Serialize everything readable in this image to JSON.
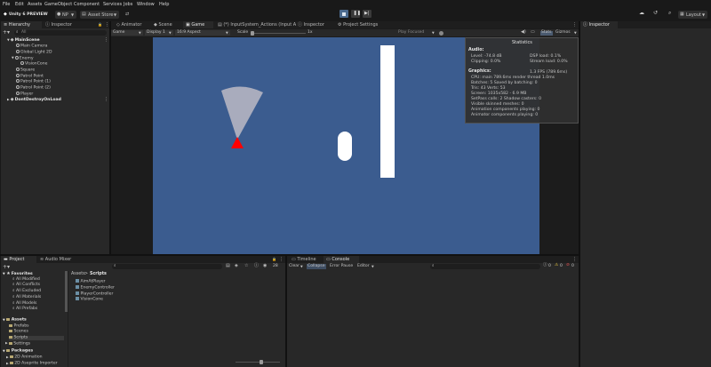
{
  "menu": [
    "File",
    "Edit",
    "Assets",
    "GameObject",
    "Component",
    "Services",
    "Jobs",
    "Window",
    "Help"
  ],
  "toolbar": {
    "app_badge": "Unity 6 PREVIEW",
    "account": "NP",
    "asset_store": "Asset Store",
    "layout": "Layout"
  },
  "tabs": {
    "hierarchy": "Hierarchy",
    "inspector_left": "Inspector",
    "animator": "Animator",
    "scene": "Scene",
    "game": "Game",
    "input_actions": "(*) InputSystem_Actions (Input A",
    "inspector_mid": "Inspector",
    "project_settings": "Project Settings",
    "inspector_right": "Inspector",
    "project": "Project",
    "audio_mixer": "Audio Mixer",
    "timeline": "Timeline",
    "console": "Console"
  },
  "game_toolbar": {
    "mode": "Game",
    "display": "Display 1",
    "aspect": "16:9 Aspect",
    "scale_label": "Scale",
    "scale_value": "1x",
    "play_focused": "Play Focused",
    "stats": "Stats",
    "gizmos": "Gizmos"
  },
  "hierarchy": {
    "search_placeholder": "All",
    "items": [
      {
        "label": "MainScene",
        "level": 0,
        "kind": "scene"
      },
      {
        "label": "Main Camera",
        "level": 2,
        "kind": "obj"
      },
      {
        "label": "Global Light 2D",
        "level": 2,
        "kind": "obj"
      },
      {
        "label": "Enemy",
        "level": 2,
        "kind": "obj"
      },
      {
        "label": "VisionCone",
        "level": 3,
        "kind": "obj"
      },
      {
        "label": "Square",
        "level": 2,
        "kind": "obj"
      },
      {
        "label": "Patrol Point",
        "level": 2,
        "kind": "obj"
      },
      {
        "label": "Patrol Point (1)",
        "level": 2,
        "kind": "obj"
      },
      {
        "label": "Patrol Point (2)",
        "level": 2,
        "kind": "obj"
      },
      {
        "label": "Player",
        "level": 2,
        "kind": "obj"
      },
      {
        "label": "DontDestroyOnLoad",
        "level": 0,
        "kind": "scene"
      }
    ]
  },
  "stats": {
    "title": "Statistics",
    "audio_header": "Audio:",
    "level": "Level: -74.8 dB",
    "clipping": "Clipping: 0.0%",
    "dsp_load": "DSP load: 0.1%",
    "stream_load": "Stream load: 0.0%",
    "graphics_header": "Graphics:",
    "fps": "1.3 FPS (789.6ms)",
    "cpu": "CPU: main 789.6ms  render thread 1.0ms",
    "batches": "Batches: 5     Saved by batching: 0",
    "tris": "Tris: 43      Verts: 53",
    "screen": "Screen: 1035x582 - 6.9 MB",
    "setpass": "SetPass calls: 2  Shadow casters: 0",
    "skinned": "Visible skinned meshes: 0",
    "anim_components": "Animation components playing: 0",
    "animator_components": "Animator components playing: 0"
  },
  "project": {
    "favorites_header": "Favorites",
    "favorites": [
      "All Modified",
      "All Conflicts",
      "All Excluded",
      "All Materials",
      "All Models",
      "All Prefabs"
    ],
    "assets_header": "Assets",
    "asset_folders": [
      "Prefabs",
      "Scenes",
      "Scripts",
      "Settings"
    ],
    "packages_header": "Packages",
    "packages": [
      "2D Animation",
      "2D Aseprite Importer"
    ],
    "breadcrumb_root": "Assets",
    "breadcrumb_sep": ">",
    "breadcrumb_current": "Scripts",
    "files": [
      "AimAtPlayer",
      "EnemyController",
      "PlayerController",
      "VisionCone"
    ],
    "hidden_count": "28"
  },
  "console": {
    "clear": "Clear",
    "collapse": "Collapse",
    "error_pause": "Error Pause",
    "editor": "Editor",
    "count_info": "0",
    "count_warn": "0",
    "count_error": "0"
  },
  "colors": {
    "game_bg": "#3b5c8f",
    "enemy": "#ff0000",
    "vision_cone": "#a9acbd"
  }
}
